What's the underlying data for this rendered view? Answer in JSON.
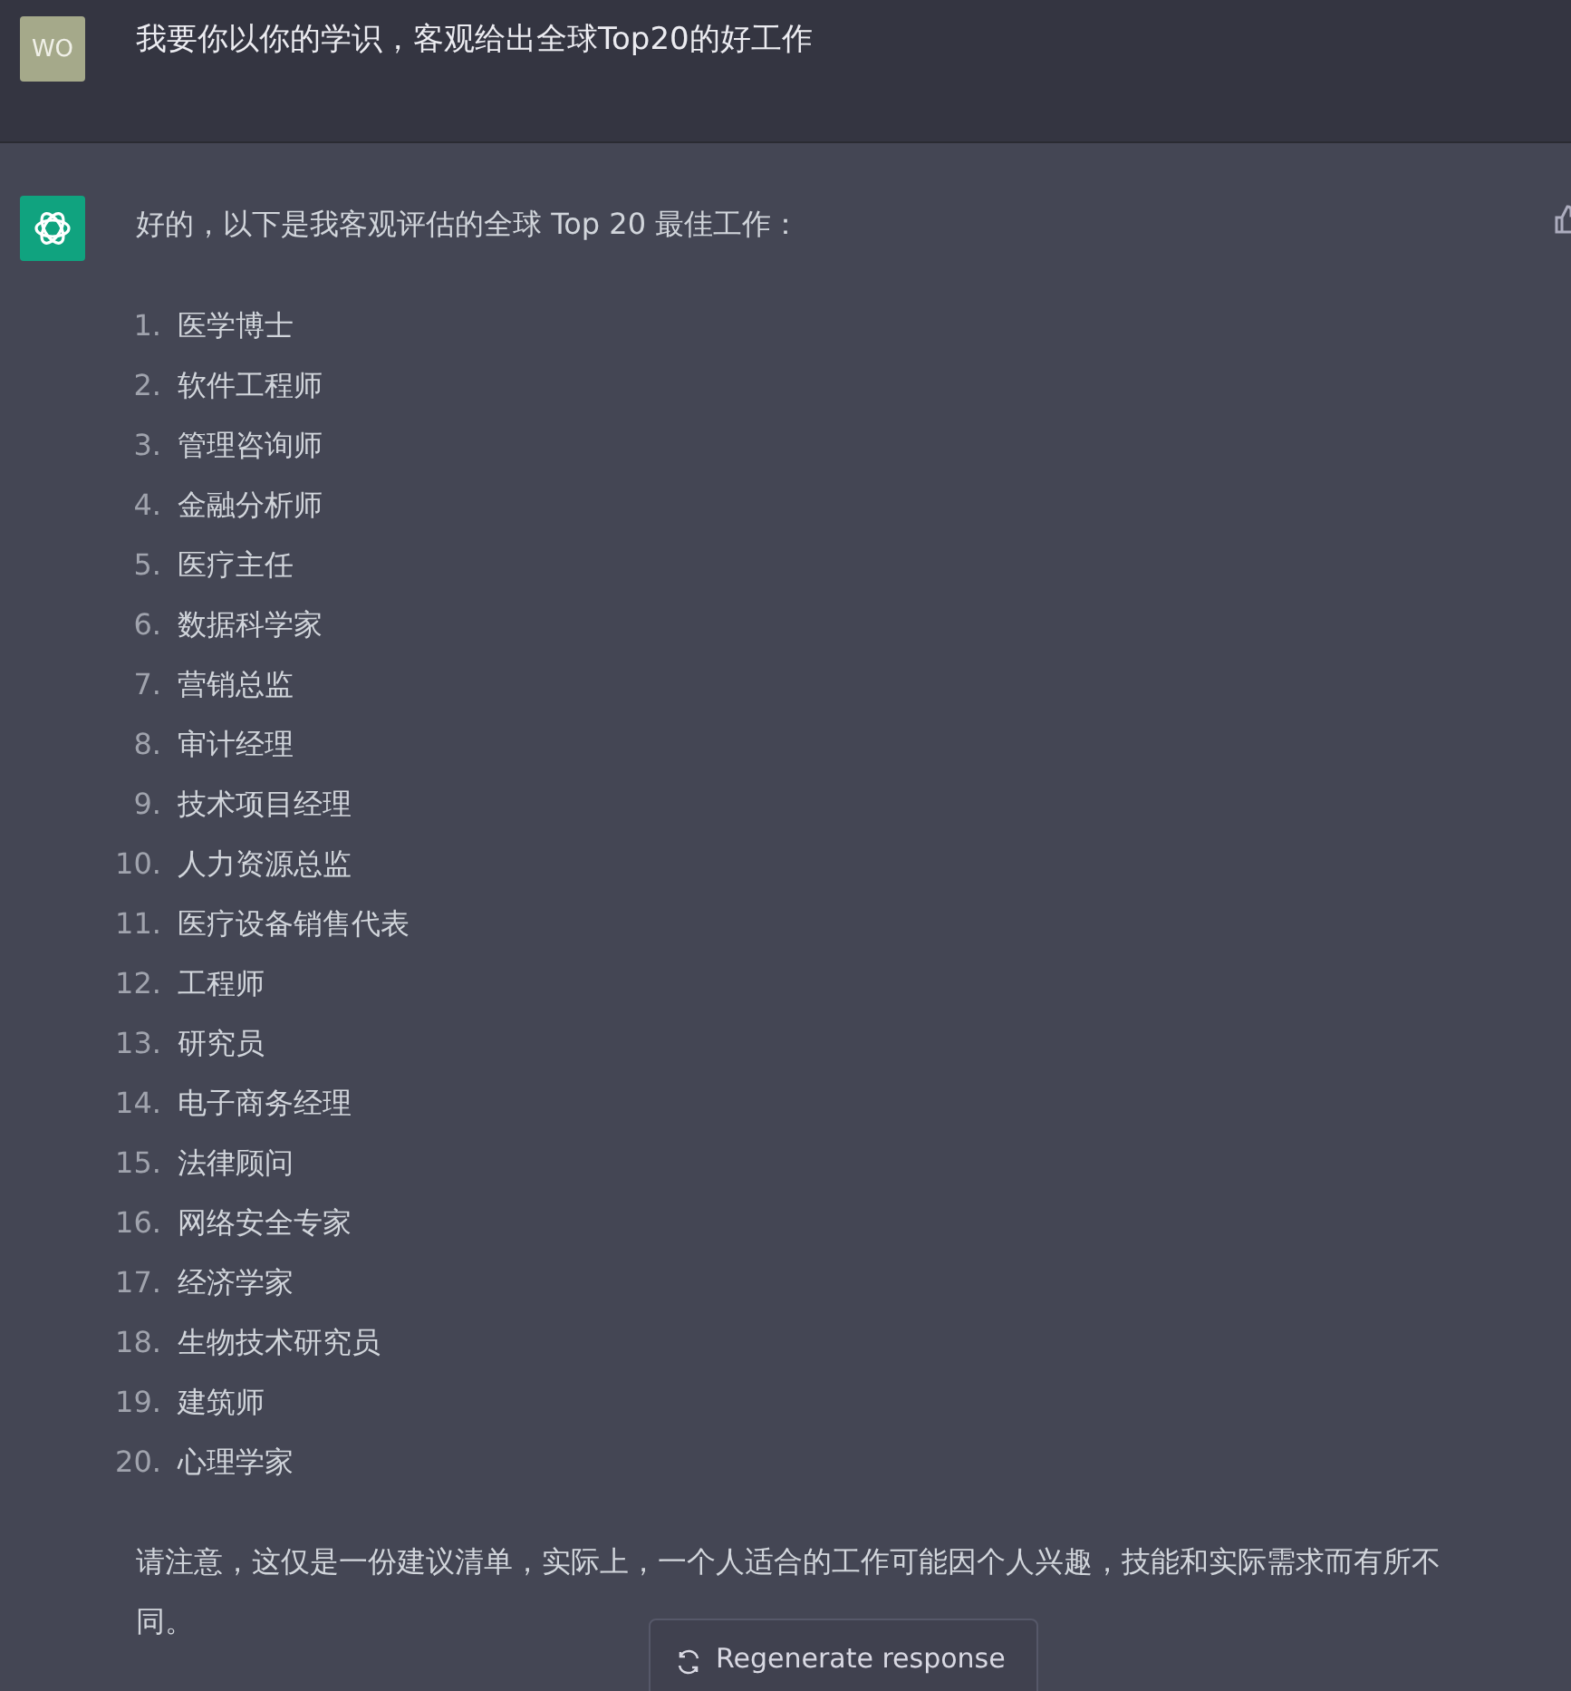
{
  "user_message": {
    "avatar": "WO",
    "text": "我要你以你的学识，客观给出全球Top20的好工作"
  },
  "assistant_message": {
    "intro": "好的，以下是我客观评估的全球 Top 20 最佳工作：",
    "items": [
      {
        "number": "1.",
        "text": "医学博士"
      },
      {
        "number": "2.",
        "text": "软件工程师"
      },
      {
        "number": "3.",
        "text": "管理咨询师"
      },
      {
        "number": "4.",
        "text": "金融分析师"
      },
      {
        "number": "5.",
        "text": "医疗主任"
      },
      {
        "number": "6.",
        "text": "数据科学家"
      },
      {
        "number": "7.",
        "text": "营销总监"
      },
      {
        "number": "8.",
        "text": "审计经理"
      },
      {
        "number": "9.",
        "text": "技术项目经理"
      },
      {
        "number": "10.",
        "text": "人力资源总监"
      },
      {
        "number": "11.",
        "text": "医疗设备销售代表"
      },
      {
        "number": "12.",
        "text": "工程师"
      },
      {
        "number": "13.",
        "text": "研究员"
      },
      {
        "number": "14.",
        "text": "电子商务经理"
      },
      {
        "number": "15.",
        "text": "法律顾问"
      },
      {
        "number": "16.",
        "text": "网络安全专家"
      },
      {
        "number": "17.",
        "text": "经济学家"
      },
      {
        "number": "18.",
        "text": "生物技术研究员"
      },
      {
        "number": "19.",
        "text": "建筑师"
      },
      {
        "number": "20.",
        "text": "心理学家"
      }
    ],
    "note": "请注意，这仅是一份建议清单，实际上，一个人适合的工作可能因个人兴趣，技能和实际需求而有所不同。"
  },
  "regenerate_button": {
    "label": "Regenerate response"
  }
}
